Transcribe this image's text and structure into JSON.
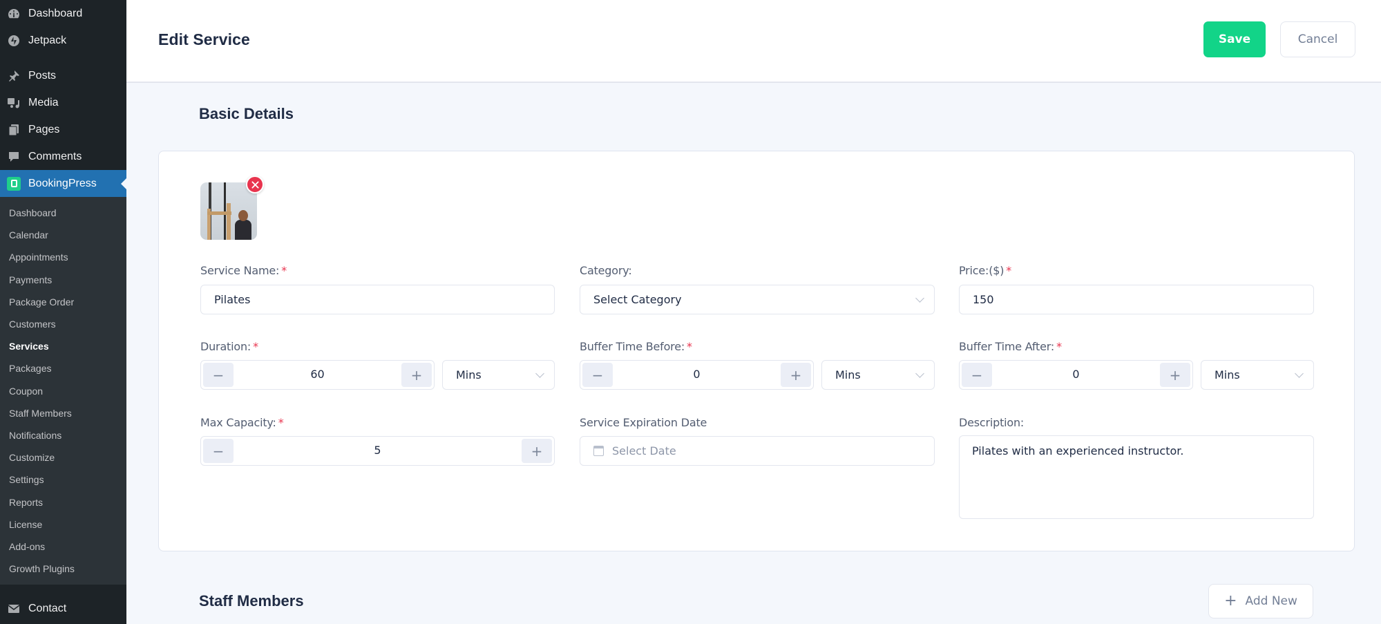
{
  "sidebar": {
    "top_items": [
      {
        "label": "Dashboard",
        "icon": "dashboard-icon"
      },
      {
        "label": "Jetpack",
        "icon": "jetpack-icon"
      }
    ],
    "main_items": [
      {
        "label": "Posts",
        "icon": "pin-icon"
      },
      {
        "label": "Media",
        "icon": "media-icon"
      },
      {
        "label": "Pages",
        "icon": "pages-icon"
      },
      {
        "label": "Comments",
        "icon": "comment-icon"
      }
    ],
    "active_item": {
      "label": "BookingPress",
      "icon": "bookingpress-icon"
    },
    "submenu": [
      {
        "label": "Dashboard"
      },
      {
        "label": "Calendar"
      },
      {
        "label": "Appointments"
      },
      {
        "label": "Payments"
      },
      {
        "label": "Package Order"
      },
      {
        "label": "Customers"
      },
      {
        "label": "Services",
        "current": true
      },
      {
        "label": "Packages"
      },
      {
        "label": "Coupon"
      },
      {
        "label": "Staff Members"
      },
      {
        "label": "Notifications"
      },
      {
        "label": "Customize"
      },
      {
        "label": "Settings"
      },
      {
        "label": "Reports"
      },
      {
        "label": "License"
      },
      {
        "label": "Add-ons"
      },
      {
        "label": "Growth Plugins"
      }
    ],
    "bottom_item": {
      "label": "Contact",
      "icon": "mail-icon"
    }
  },
  "header": {
    "title": "Edit Service",
    "save_label": "Save",
    "cancel_label": "Cancel"
  },
  "basic_details": {
    "title": "Basic Details",
    "service_name": {
      "label": "Service Name:",
      "required": "*",
      "value": "Pilates"
    },
    "category": {
      "label": "Category:",
      "placeholder": "Select Category"
    },
    "price": {
      "label": "Price:($)",
      "required": "*",
      "value": "150"
    },
    "duration": {
      "label": "Duration:",
      "required": "*",
      "value": "60",
      "unit": "Mins"
    },
    "buffer_before": {
      "label": "Buffer Time Before:",
      "required": "*",
      "value": "0",
      "unit": "Mins"
    },
    "buffer_after": {
      "label": "Buffer Time After:",
      "required": "*",
      "value": "0",
      "unit": "Mins"
    },
    "max_capacity": {
      "label": "Max Capacity:",
      "required": "*",
      "value": "5"
    },
    "expiration": {
      "label": "Service Expiration Date",
      "placeholder": "Select Date"
    },
    "description": {
      "label": "Description:",
      "value": "Pilates with an experienced instructor."
    },
    "stepper_minus": "−",
    "stepper_plus": "+"
  },
  "staff_members": {
    "title": "Staff Members",
    "add_label": "Add New",
    "add_icon": "+"
  },
  "colors": {
    "accent": "#12d488",
    "sidebar_bg": "#1d2327",
    "sidebar_active": "#2271b1",
    "required": "#e8344e"
  }
}
